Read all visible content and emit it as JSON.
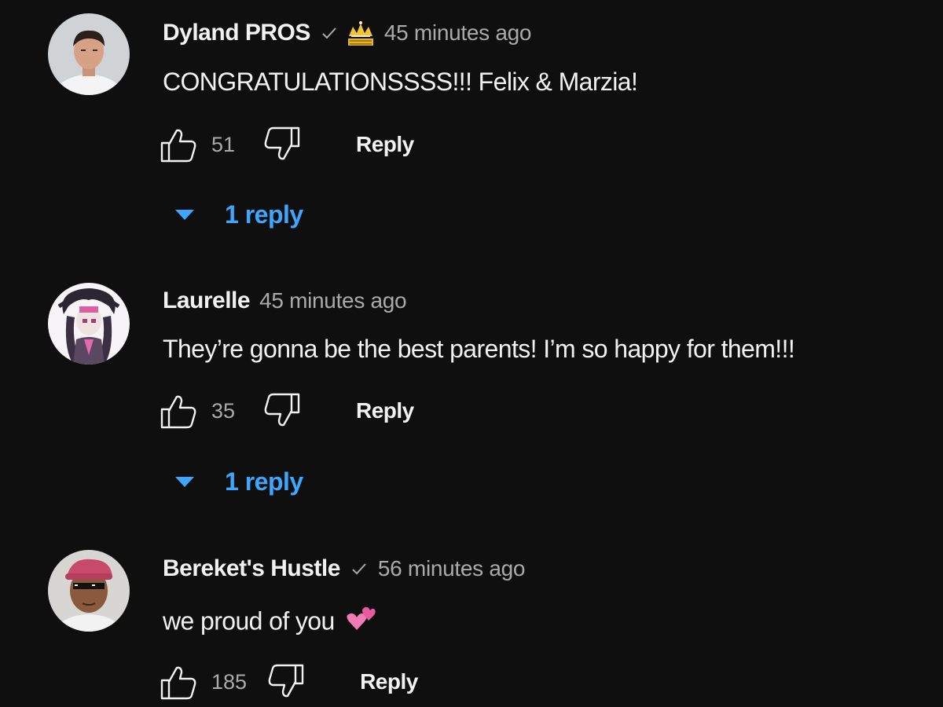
{
  "comments": [
    {
      "author": "Dyland PROS",
      "verified_icon": "checkmark-icon",
      "member_badge_icon": "crown-badge-icon",
      "time": "45 minutes ago",
      "text": "CONGRATULATIONSSSS!!! Felix & Marzia!",
      "likes": "51",
      "reply_label": "Reply",
      "replies_label": "1 reply",
      "avatar_icon": "user-avatar"
    },
    {
      "author": "Laurelle",
      "time": "45 minutes ago",
      "text": "They’re gonna be the best parents! I’m so happy for them!!!",
      "likes": "35",
      "reply_label": "Reply",
      "replies_label": "1 reply",
      "avatar_icon": "anime-avatar"
    },
    {
      "author": "Bereket's Hustle",
      "verified_icon": "checkmark-icon",
      "time": "56 minutes ago",
      "text": "we proud of you",
      "emoji": "💕",
      "likes": "185",
      "reply_label": "Reply",
      "avatar_icon": "user-avatar-sunglasses"
    }
  ],
  "colors": {
    "background": "#0f0f0f",
    "primary_text": "#f1f1f1",
    "secondary_text": "#aaaaaa",
    "link_blue": "#3ea6ff"
  }
}
